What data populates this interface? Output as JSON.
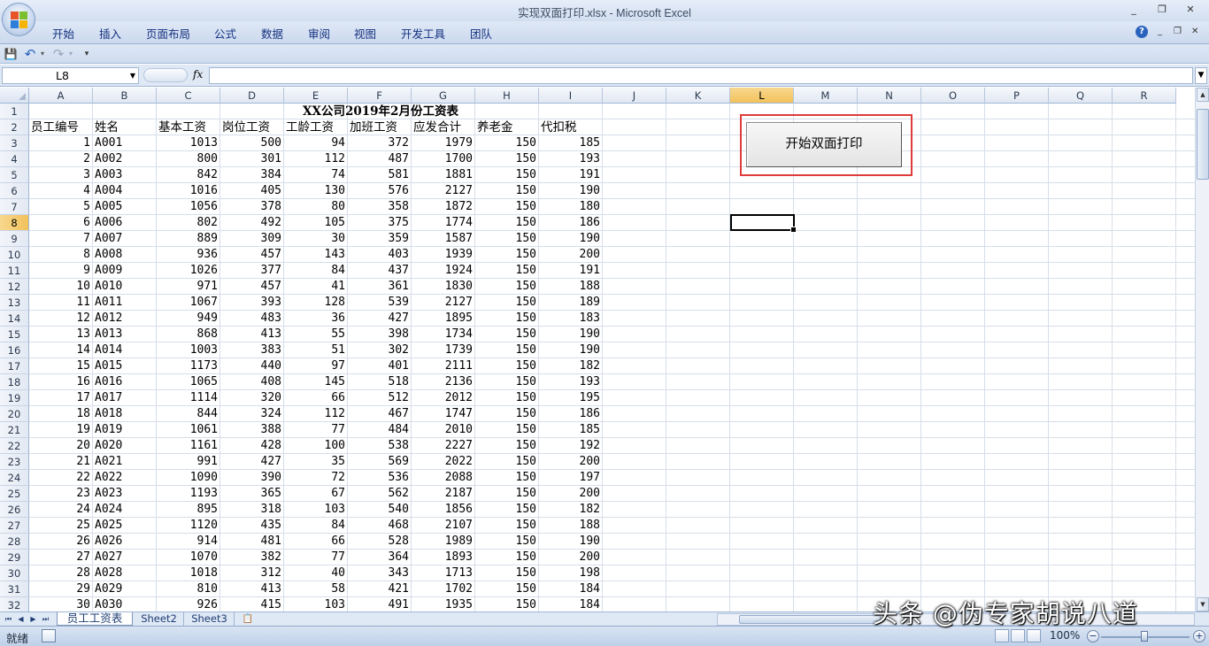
{
  "window": {
    "title": "实现双面打印.xlsx - Microsoft Excel",
    "min": "_",
    "restore": "❐",
    "close": "✕"
  },
  "ribbon": {
    "tabs": [
      "开始",
      "插入",
      "页面布局",
      "公式",
      "数据",
      "审阅",
      "视图",
      "开发工具",
      "团队"
    ],
    "help": "?"
  },
  "qat": {
    "save": "💾",
    "undo": "↶",
    "redo": "↷",
    "customize": "▾"
  },
  "formula_bar": {
    "name_box": "L8",
    "fx": "fx",
    "formula": ""
  },
  "grid": {
    "columns": [
      "A",
      "B",
      "C",
      "D",
      "E",
      "F",
      "G",
      "H",
      "I",
      "J",
      "K",
      "L",
      "M",
      "N",
      "O",
      "P",
      "Q",
      "R"
    ],
    "selected_column": "L",
    "rows": [
      "1",
      "2",
      "3",
      "4",
      "5",
      "6",
      "7",
      "8",
      "9",
      "10",
      "11",
      "12",
      "13",
      "14",
      "15",
      "16",
      "17",
      "18",
      "19",
      "20",
      "21",
      "22",
      "23",
      "24",
      "25",
      "26",
      "27",
      "28",
      "29",
      "30",
      "31",
      "32"
    ],
    "selected_row": "8",
    "title": "XX公司2019年2月份工资表",
    "headers": [
      "员工编号",
      "姓名",
      "基本工资",
      "岗位工资",
      "工龄工资",
      "加班工资",
      "应发合计",
      "养老金",
      "代扣税"
    ],
    "data": [
      [
        "1",
        "A001",
        "1013",
        "500",
        "94",
        "372",
        "1979",
        "150",
        "185"
      ],
      [
        "2",
        "A002",
        "800",
        "301",
        "112",
        "487",
        "1700",
        "150",
        "193"
      ],
      [
        "3",
        "A003",
        "842",
        "384",
        "74",
        "581",
        "1881",
        "150",
        "191"
      ],
      [
        "4",
        "A004",
        "1016",
        "405",
        "130",
        "576",
        "2127",
        "150",
        "190"
      ],
      [
        "5",
        "A005",
        "1056",
        "378",
        "80",
        "358",
        "1872",
        "150",
        "180"
      ],
      [
        "6",
        "A006",
        "802",
        "492",
        "105",
        "375",
        "1774",
        "150",
        "186"
      ],
      [
        "7",
        "A007",
        "889",
        "309",
        "30",
        "359",
        "1587",
        "150",
        "190"
      ],
      [
        "8",
        "A008",
        "936",
        "457",
        "143",
        "403",
        "1939",
        "150",
        "200"
      ],
      [
        "9",
        "A009",
        "1026",
        "377",
        "84",
        "437",
        "1924",
        "150",
        "191"
      ],
      [
        "10",
        "A010",
        "971",
        "457",
        "41",
        "361",
        "1830",
        "150",
        "188"
      ],
      [
        "11",
        "A011",
        "1067",
        "393",
        "128",
        "539",
        "2127",
        "150",
        "189"
      ],
      [
        "12",
        "A012",
        "949",
        "483",
        "36",
        "427",
        "1895",
        "150",
        "183"
      ],
      [
        "13",
        "A013",
        "868",
        "413",
        "55",
        "398",
        "1734",
        "150",
        "190"
      ],
      [
        "14",
        "A014",
        "1003",
        "383",
        "51",
        "302",
        "1739",
        "150",
        "190"
      ],
      [
        "15",
        "A015",
        "1173",
        "440",
        "97",
        "401",
        "2111",
        "150",
        "182"
      ],
      [
        "16",
        "A016",
        "1065",
        "408",
        "145",
        "518",
        "2136",
        "150",
        "193"
      ],
      [
        "17",
        "A017",
        "1114",
        "320",
        "66",
        "512",
        "2012",
        "150",
        "195"
      ],
      [
        "18",
        "A018",
        "844",
        "324",
        "112",
        "467",
        "1747",
        "150",
        "186"
      ],
      [
        "19",
        "A019",
        "1061",
        "388",
        "77",
        "484",
        "2010",
        "150",
        "185"
      ],
      [
        "20",
        "A020",
        "1161",
        "428",
        "100",
        "538",
        "2227",
        "150",
        "192"
      ],
      [
        "21",
        "A021",
        "991",
        "427",
        "35",
        "569",
        "2022",
        "150",
        "200"
      ],
      [
        "22",
        "A022",
        "1090",
        "390",
        "72",
        "536",
        "2088",
        "150",
        "197"
      ],
      [
        "23",
        "A023",
        "1193",
        "365",
        "67",
        "562",
        "2187",
        "150",
        "200"
      ],
      [
        "24",
        "A024",
        "895",
        "318",
        "103",
        "540",
        "1856",
        "150",
        "182"
      ],
      [
        "25",
        "A025",
        "1120",
        "435",
        "84",
        "468",
        "2107",
        "150",
        "188"
      ],
      [
        "26",
        "A026",
        "914",
        "481",
        "66",
        "528",
        "1989",
        "150",
        "190"
      ],
      [
        "27",
        "A027",
        "1070",
        "382",
        "77",
        "364",
        "1893",
        "150",
        "200"
      ],
      [
        "28",
        "A028",
        "1018",
        "312",
        "40",
        "343",
        "1713",
        "150",
        "198"
      ],
      [
        "29",
        "A029",
        "810",
        "413",
        "58",
        "421",
        "1702",
        "150",
        "184"
      ],
      [
        "30",
        "A030",
        "926",
        "415",
        "103",
        "491",
        "1935",
        "150",
        "184"
      ]
    ],
    "button_label": "开始双面打印"
  },
  "sheets": {
    "tabs": [
      "员工工资表",
      "Sheet2",
      "Sheet3"
    ],
    "active": "员工工资表"
  },
  "status": {
    "ready": "就绪",
    "zoom": "100%",
    "zoom_out": "−",
    "zoom_in": "+"
  },
  "watermark": "头条 @伪专家胡说八道"
}
